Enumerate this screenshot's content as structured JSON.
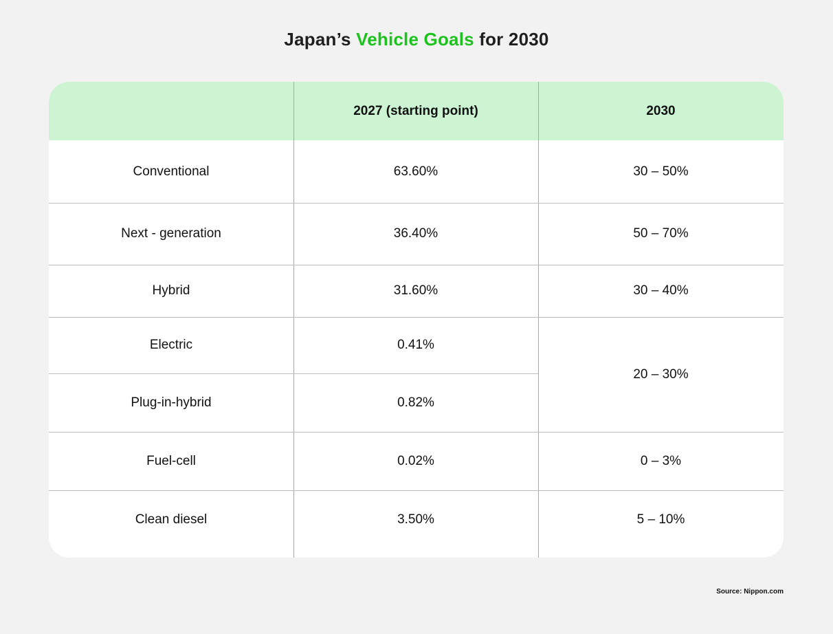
{
  "title": {
    "prefix": "Japan’s ",
    "highlight": "Vehicle Goals",
    "suffix": " for 2030",
    "accent_color": "#1ec21e"
  },
  "table": {
    "header_color": "#ccf4d3",
    "columns": [
      "",
      "2027 (starting point)",
      "2030"
    ],
    "rows": [
      {
        "category": "Conventional",
        "start_2027": "63.60%",
        "goal_2030": "30 – 50%"
      },
      {
        "category": "Next - generation",
        "start_2027": "36.40%",
        "goal_2030": "50 – 70%"
      },
      {
        "category": "Hybrid",
        "start_2027": "31.60%",
        "goal_2030": "30 – 40%"
      },
      {
        "category": "Electric",
        "start_2027": "0.41%",
        "goal_2030": "20 – 30%"
      },
      {
        "category": "Plug-in-hybrid",
        "start_2027": "0.82%",
        "goal_2030": "20 – 30%"
      },
      {
        "category": "Fuel-cell",
        "start_2027": "0.02%",
        "goal_2030": "0 – 3%"
      },
      {
        "category": "Clean diesel",
        "start_2027": "3.50%",
        "goal_2030": "5 – 10%"
      }
    ],
    "merged_note": "Electric and Plug-in-hybrid share the 2030 goal cell"
  },
  "source": "Source: Nippon.com"
}
